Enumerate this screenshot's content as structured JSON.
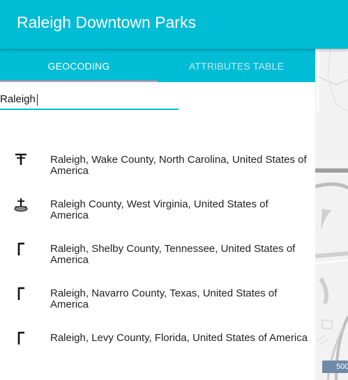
{
  "app": {
    "title": "Raleigh Downtown Parks"
  },
  "tabs": [
    {
      "label": "GEOCODING",
      "active": true
    },
    {
      "label": "ATTRIBUTES TABLE",
      "active": false
    }
  ],
  "search": {
    "value": "Raleigh"
  },
  "results": [
    {
      "label": "Raleigh, Wake County, North Carolina, United States of America",
      "icon": "city-marker-icon"
    },
    {
      "label": "Raleigh County, West Virginia, United States of America",
      "icon": "county-marker-icon"
    },
    {
      "label": "Raleigh, Shelby County, Tennessee, United States of America",
      "icon": "flag-marker-icon"
    },
    {
      "label": "Raleigh, Navarro County, Texas, United States of America",
      "icon": "flag-marker-icon"
    },
    {
      "label": "Raleigh, Levy County, Florida, United States of America",
      "icon": "flag-marker-icon"
    }
  ],
  "map": {
    "scale_label": "500"
  },
  "colors": {
    "primary": "#00bcd4",
    "tab_indicator": "#ef8fa3"
  }
}
